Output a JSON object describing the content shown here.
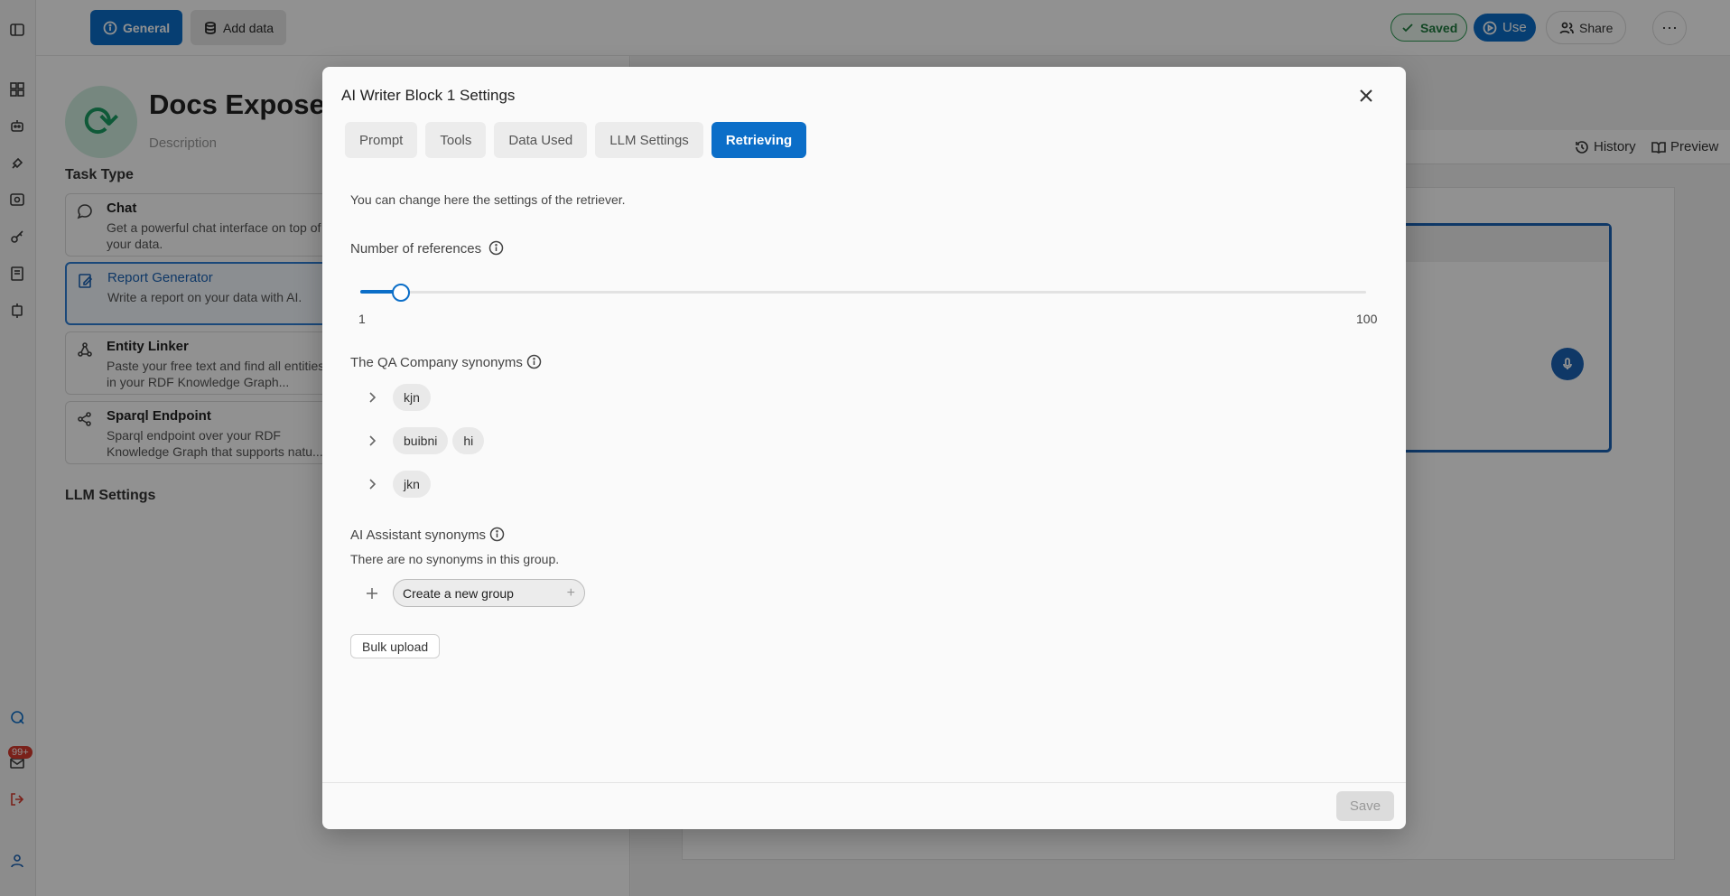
{
  "topbar": {
    "general_label": "General",
    "add_data_label": "Add data",
    "saved_label": "Saved",
    "use_label": "Use",
    "share_label": "Share",
    "more_label": "⋯"
  },
  "rail": {
    "badge": "99+"
  },
  "project": {
    "title": "Docs Expose S",
    "description_placeholder": "Description"
  },
  "task_type": {
    "heading": "Task Type",
    "items": [
      {
        "title": "Chat",
        "desc": "Get a powerful chat interface on top of your data."
      },
      {
        "title": "Report Generator",
        "desc": "Write a report on your data with AI."
      },
      {
        "title": "Entity Linker",
        "desc": "Paste your free text and find all entities in your RDF Knowledge Graph..."
      },
      {
        "title": "Sparql Endpoint",
        "desc": "Sparql endpoint over your RDF Knowledge Graph that supports natu..."
      }
    ]
  },
  "llm_settings_heading": "LLM Settings",
  "right_bar": {
    "history_label": "History",
    "preview_label": "Preview"
  },
  "modal": {
    "title": "AI Writer Block 1 Settings",
    "tabs": [
      "Prompt",
      "Tools",
      "Data Used",
      "LLM Settings",
      "Retrieving"
    ],
    "active_tab": "Retrieving",
    "intro": "You can change here the settings of the retriever.",
    "references": {
      "label": "Number of references",
      "min": "1",
      "max": "100",
      "value": 5
    },
    "qa_synonyms": {
      "label": "The QA Company synonyms",
      "groups": [
        [
          "kjn"
        ],
        [
          "buibni",
          "hi"
        ],
        [
          "jkn"
        ]
      ]
    },
    "ai_synonyms": {
      "label": "AI Assistant synonyms",
      "empty_text": "There are no synonyms in this group.",
      "new_group_placeholder": "Create a new group"
    },
    "bulk_upload_label": "Bulk upload",
    "save_label": "Save"
  },
  "colors": {
    "accent": "#0b6ec8",
    "saved_green": "#1e7b3f",
    "badge_red": "#d63a2f"
  }
}
